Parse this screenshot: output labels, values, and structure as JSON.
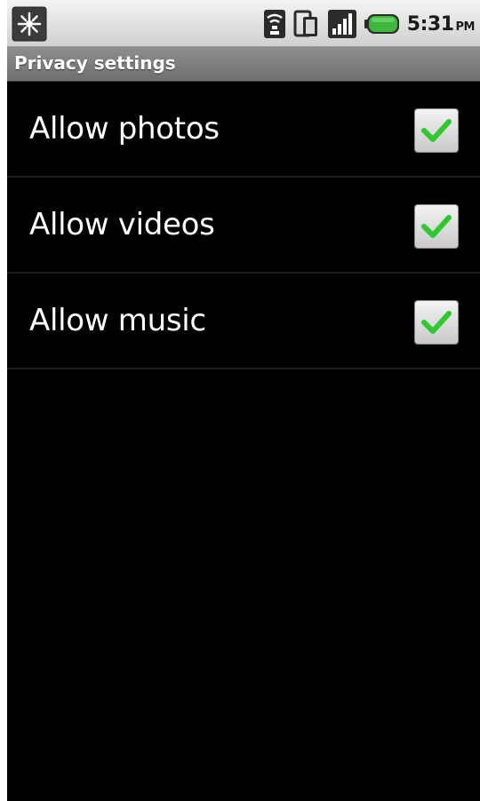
{
  "status_bar": {
    "time": "5:31",
    "ampm": "PM",
    "icons": [
      "notification-icon",
      "wifi-icon",
      "sync-icon",
      "signal-icon",
      "battery-icon"
    ],
    "battery_color": "#3db83a"
  },
  "title_bar": {
    "title": "Privacy settings"
  },
  "settings": {
    "items": [
      {
        "label": "Allow photos",
        "checked": true
      },
      {
        "label": "Allow videos",
        "checked": true
      },
      {
        "label": "Allow music",
        "checked": true
      }
    ]
  },
  "colors": {
    "background": "#000000",
    "check": "#2fc82f"
  }
}
